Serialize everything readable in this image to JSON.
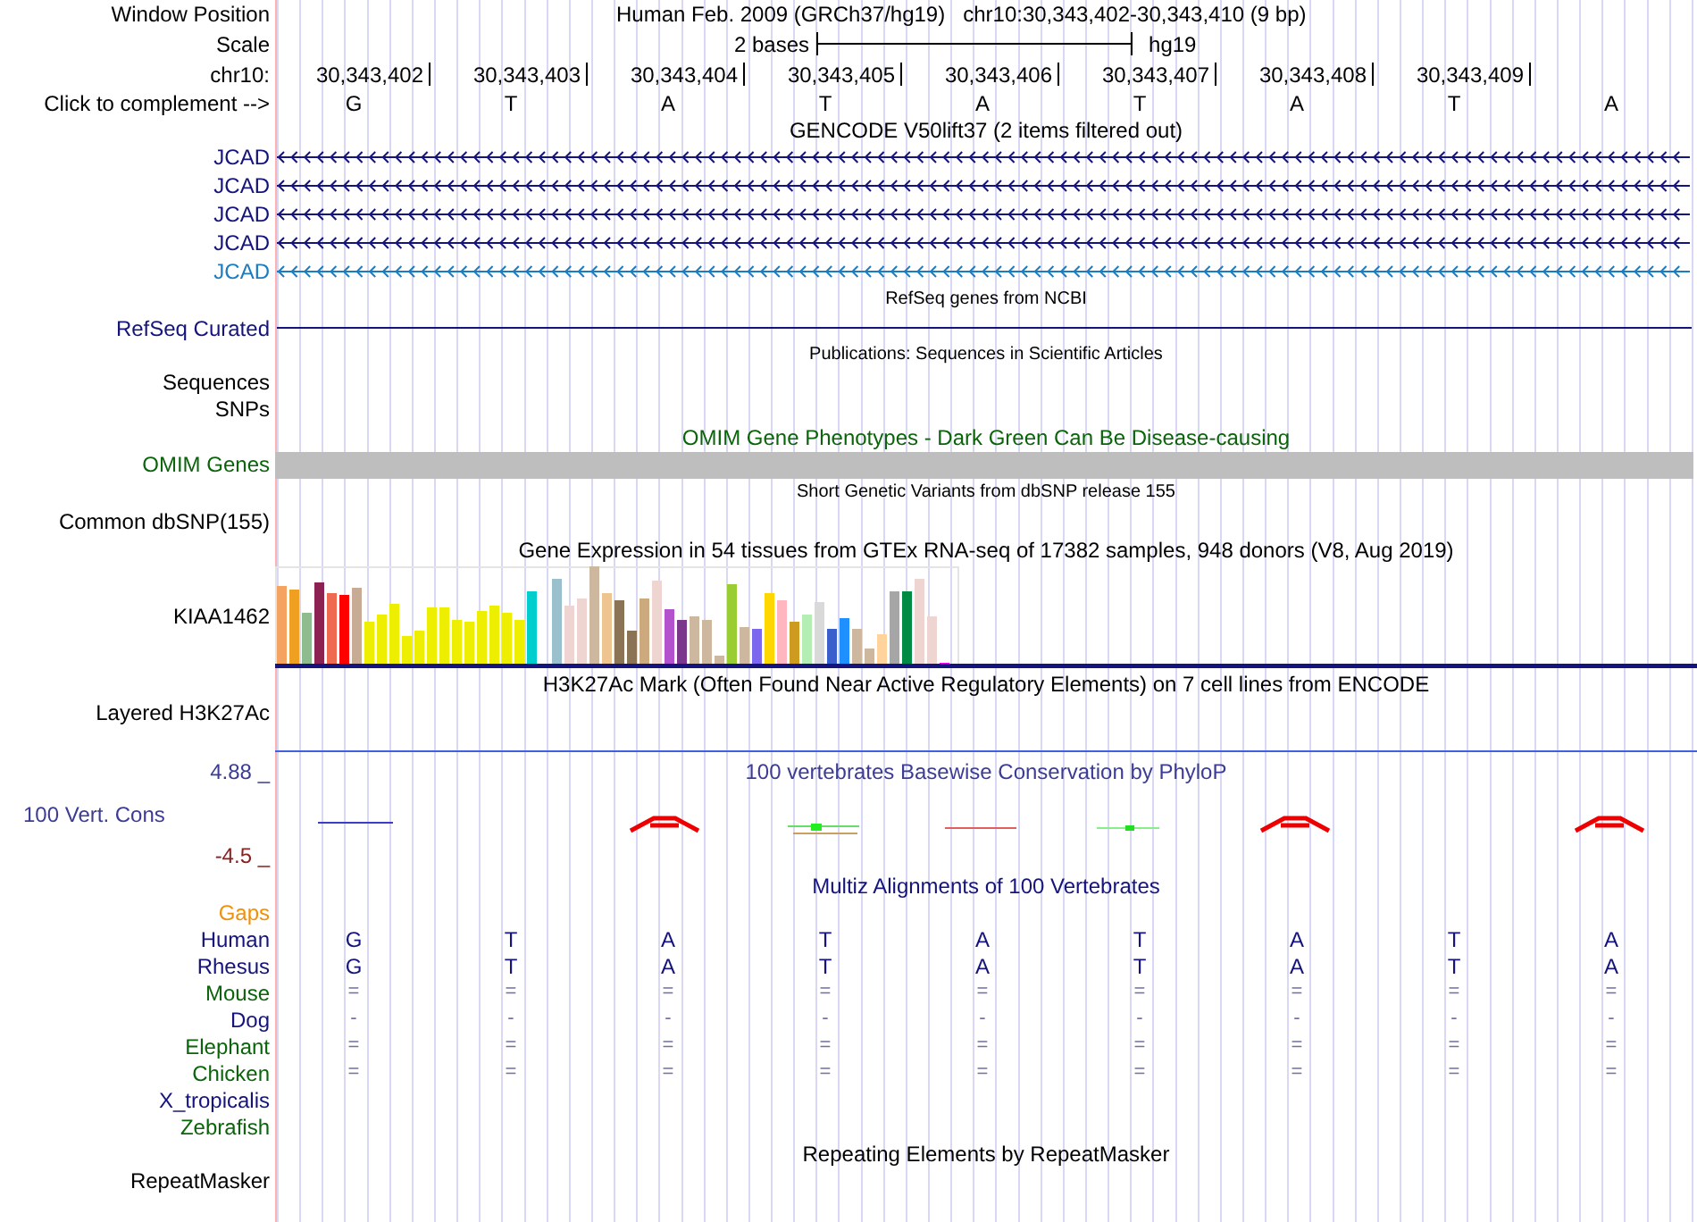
{
  "header": {
    "window_position_label": "Window Position",
    "assembly": "Human Feb. 2009 (GRCh37/hg19)",
    "position": "chr10:30,343,402-30,343,410 (9 bp)",
    "scale_label": "Scale",
    "scale_text": "2 bases",
    "scale_db": "hg19",
    "chrom_label": "chr10:",
    "complement_label": "Click to complement -->"
  },
  "bases": [
    {
      "coordinate": "30,343,402",
      "base": "G"
    },
    {
      "coordinate": "30,343,403",
      "base": "T"
    },
    {
      "coordinate": "30,343,404",
      "base": "A"
    },
    {
      "coordinate": "30,343,405",
      "base": "T"
    },
    {
      "coordinate": "30,343,406",
      "base": "A"
    },
    {
      "coordinate": "30,343,407",
      "base": "T"
    },
    {
      "coordinate": "30,343,408",
      "base": "A"
    },
    {
      "coordinate": "30,343,409",
      "base": "T"
    },
    {
      "base": "A"
    }
  ],
  "tracks": [
    {
      "kind": "gene",
      "title": "GENCODE V50lift37 (2 items filtered out)",
      "items": [
        {
          "label": "JCAD",
          "color": "#14147c"
        },
        {
          "label": "JCAD",
          "color": "#14147c"
        },
        {
          "label": "JCAD",
          "color": "#14147c"
        },
        {
          "label": "JCAD",
          "color": "#14147c"
        },
        {
          "label": "JCAD",
          "color": "#1c7cc0"
        }
      ]
    },
    {
      "kind": "line",
      "title": "RefSeq genes from NCBI",
      "label": "RefSeq Curated",
      "color": "#14147c"
    },
    {
      "kind": "labels",
      "title": "Publications: Sequences in Scientific Articles",
      "labels": [
        "Sequences",
        "SNPs"
      ]
    },
    {
      "kind": "bar",
      "title": "OMIM Gene Phenotypes - Dark Green Can Be Disease-causing",
      "label": "OMIM Genes",
      "color": "#0a640a"
    },
    {
      "kind": "variants",
      "title": "Short Genetic Variants from dbSNP release 155",
      "label": "Common dbSNP(155)"
    },
    {
      "kind": "gtex",
      "title": "Gene Expression in 54 tissues from GTEx RNA-seq of 17382 samples, 948 donors (V8, Aug 2019)",
      "label": "KIAA1462"
    },
    {
      "kind": "signal",
      "title": "H3K27Ac Mark (Often Found Near Active Regulatory Elements) on 7 cell lines from ENCODE",
      "label": "Layered H3K27Ac"
    },
    {
      "kind": "phylop",
      "title": "100 vertebrates Basewise Conservation by PhyloP",
      "label": "100 Vert. Cons",
      "ymax": "4.88 _",
      "ymin": "-4.5 _",
      "color": "#3c3c94"
    },
    {
      "kind": "multiz",
      "title": "Multiz Alignments of 100 Vertebrates",
      "color": "#14147c",
      "species": [
        {
          "name": "Gaps",
          "color": "#f0900a"
        },
        {
          "name": "Human",
          "color": "#14147c",
          "kind": "bases",
          "bases": [
            "G",
            "T",
            "A",
            "T",
            "A",
            "T",
            "A",
            "T",
            "A"
          ]
        },
        {
          "name": "Rhesus",
          "color": "#14147c",
          "kind": "bases",
          "bases": [
            "G",
            "T",
            "A",
            "T",
            "A",
            "T",
            "A",
            "T",
            "A"
          ]
        },
        {
          "name": "Mouse",
          "color": "#0a640a",
          "kind": "symbols",
          "bases": [
            "=",
            "=",
            "=",
            "=",
            "=",
            "=",
            "=",
            "=",
            "="
          ]
        },
        {
          "name": "Dog",
          "color": "#14147c",
          "kind": "symbols",
          "bases": [
            "-",
            "-",
            "-",
            "-",
            "-",
            "-",
            "-",
            "-",
            "-"
          ]
        },
        {
          "name": "Elephant",
          "color": "#0a640a",
          "kind": "symbols",
          "bases": [
            "=",
            "=",
            "=",
            "=",
            "=",
            "=",
            "=",
            "=",
            "="
          ]
        },
        {
          "name": "Chicken",
          "color": "#0a640a",
          "kind": "symbols",
          "bases": [
            "=",
            "=",
            "=",
            "=",
            "=",
            "=",
            "=",
            "=",
            "="
          ]
        },
        {
          "name": "X_tropicalis",
          "color": "#14147c"
        },
        {
          "name": "Zebrafish",
          "color": "#0a640a"
        }
      ]
    },
    {
      "kind": "repeats",
      "title": "Repeating Elements by RepeatMasker",
      "label": "RepeatMasker"
    }
  ]
}
